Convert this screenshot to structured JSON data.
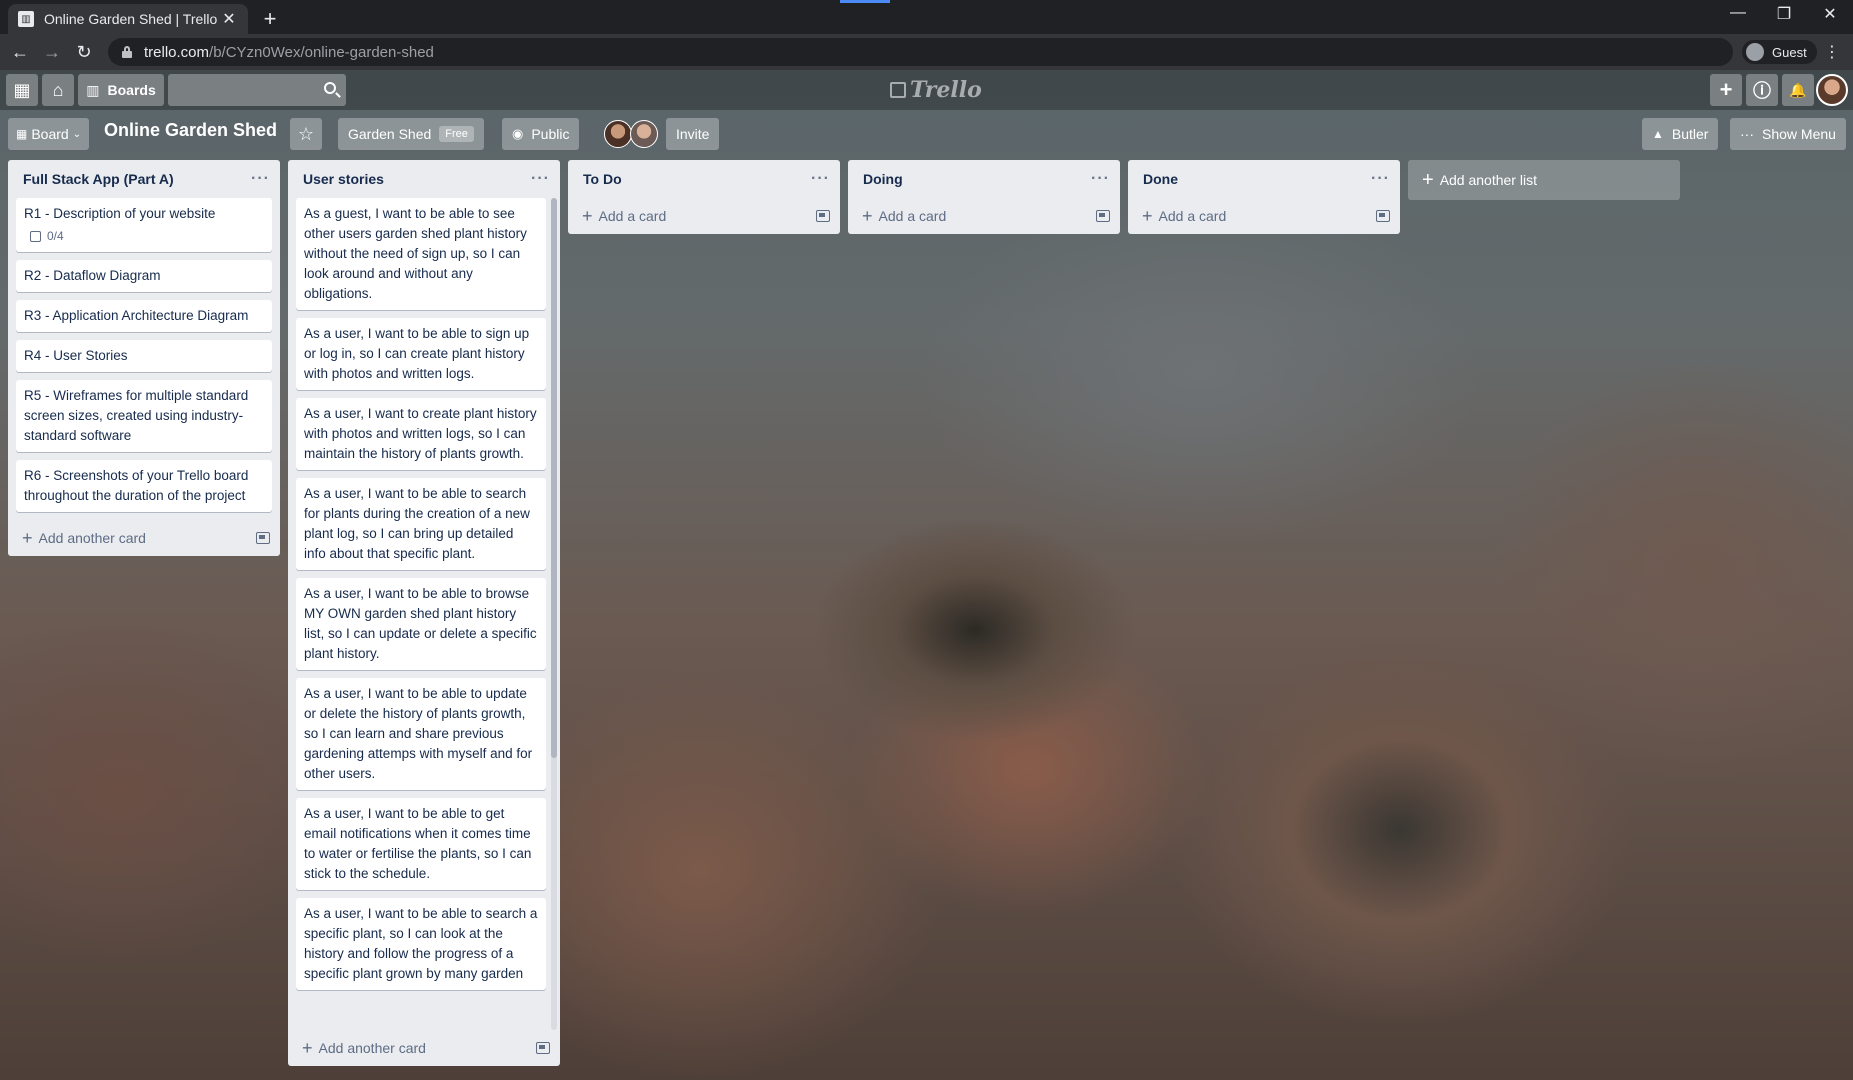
{
  "browser": {
    "tab_title": "Online Garden Shed | Trello",
    "tab_close": "✕",
    "new_tab": "+",
    "url_host": "trello.com",
    "url_path": "/b/CYzn0Wex/online-garden-shed",
    "profile_label": "Guest",
    "back": "←",
    "forward": "→",
    "reload": "↻",
    "minimize": "—",
    "restore": "❐",
    "close": "✕",
    "menu": "⋮"
  },
  "topnav": {
    "apps_icon": "▦",
    "home_icon": "⌂",
    "boards_label": "Boards",
    "logo_text": "Trello",
    "create_icon": "+",
    "info_icon": "ⓘ",
    "notifications_icon": "🔔"
  },
  "board_header": {
    "view_label": "Board",
    "title": "Online Garden Shed",
    "star_icon": "☆",
    "team_label": "Garden Shed",
    "team_badge": "Free",
    "visibility_label": "Public",
    "invite_label": "Invite",
    "butler_label": "Butler",
    "show_menu_label": "Show Menu"
  },
  "lists": [
    {
      "title": "Full Stack App (Part A)",
      "cards": [
        {
          "text": "R1 - Description of your website",
          "badge": "0/4"
        },
        {
          "text": "R2 - Dataflow Diagram"
        },
        {
          "text": "R3 - Application Architecture Diagram"
        },
        {
          "text": "R4 - User Stories"
        },
        {
          "text": "R5 - Wireframes for multiple standard screen sizes, created using industry-standard software"
        },
        {
          "text": "R6 - Screenshots of your Trello board throughout the duration of the project"
        }
      ],
      "footer": "Add another card"
    },
    {
      "title": "User stories",
      "cards": [
        {
          "text": "As a guest, I want to be able to see other users garden shed plant history without the need of sign up, so I can look around and without any obligations."
        },
        {
          "text": "As a user, I want to be able to sign up or log in, so I can create plant history with photos and written logs."
        },
        {
          "text": "As a user, I want to create plant history with photos and written logs, so I can maintain the history of plants growth."
        },
        {
          "text": "As a user, I want to be able to search for plants during the creation of a new plant log, so I can bring up detailed info about that specific plant."
        },
        {
          "text": "As a user, I want to be able to browse MY OWN garden shed plant history list, so I can update or delete a specific plant history."
        },
        {
          "text": "As a user, I want to be able to update or delete the history of plants growth, so I can learn and share previous gardening attemps with myself and for other users."
        },
        {
          "text": "As a user, I want to be able to get email notifications when it comes time to water or fertilise the plants, so I can stick to the schedule."
        },
        {
          "text": "As a user, I want to be able to search a specific plant, so I can look at the history and follow the progress of a specific plant grown by many garden"
        }
      ],
      "footer": "Add another card"
    },
    {
      "title": "To Do",
      "cards": [],
      "footer": "Add a card"
    },
    {
      "title": "Doing",
      "cards": [],
      "footer": "Add a card"
    },
    {
      "title": "Done",
      "cards": [],
      "footer": "Add a card"
    }
  ],
  "list_menu": "···",
  "add_list_label": "Add another list"
}
